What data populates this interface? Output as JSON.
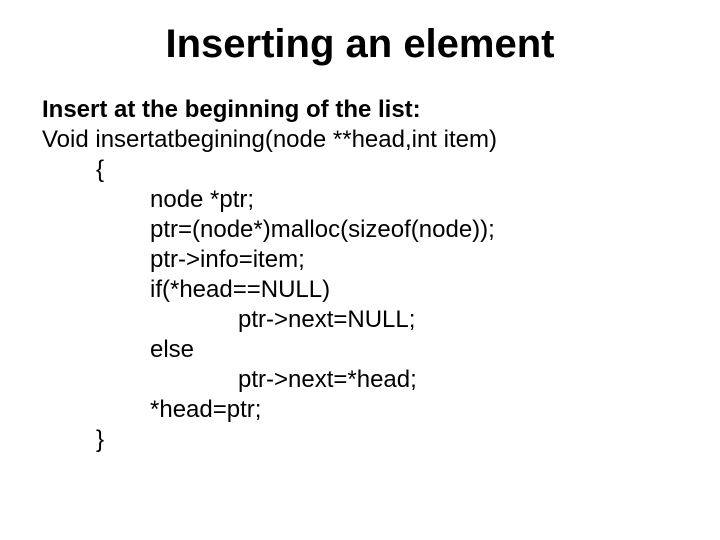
{
  "title": "Inserting an element",
  "subhead": "Insert at the beginning of the list:",
  "lines": {
    "l0": "Void insertatbegining(node **head,int item)",
    "l1": "{",
    "l2": "node *ptr;",
    "l3": "ptr=(node*)malloc(sizeof(node));",
    "l4": "ptr->info=item;",
    "l5": "if(*head==NULL)",
    "l6": "ptr->next=NULL;",
    "l7": "else",
    "l8": "ptr->next=*head;",
    "l9": "*head=ptr;",
    "l10": "}"
  }
}
